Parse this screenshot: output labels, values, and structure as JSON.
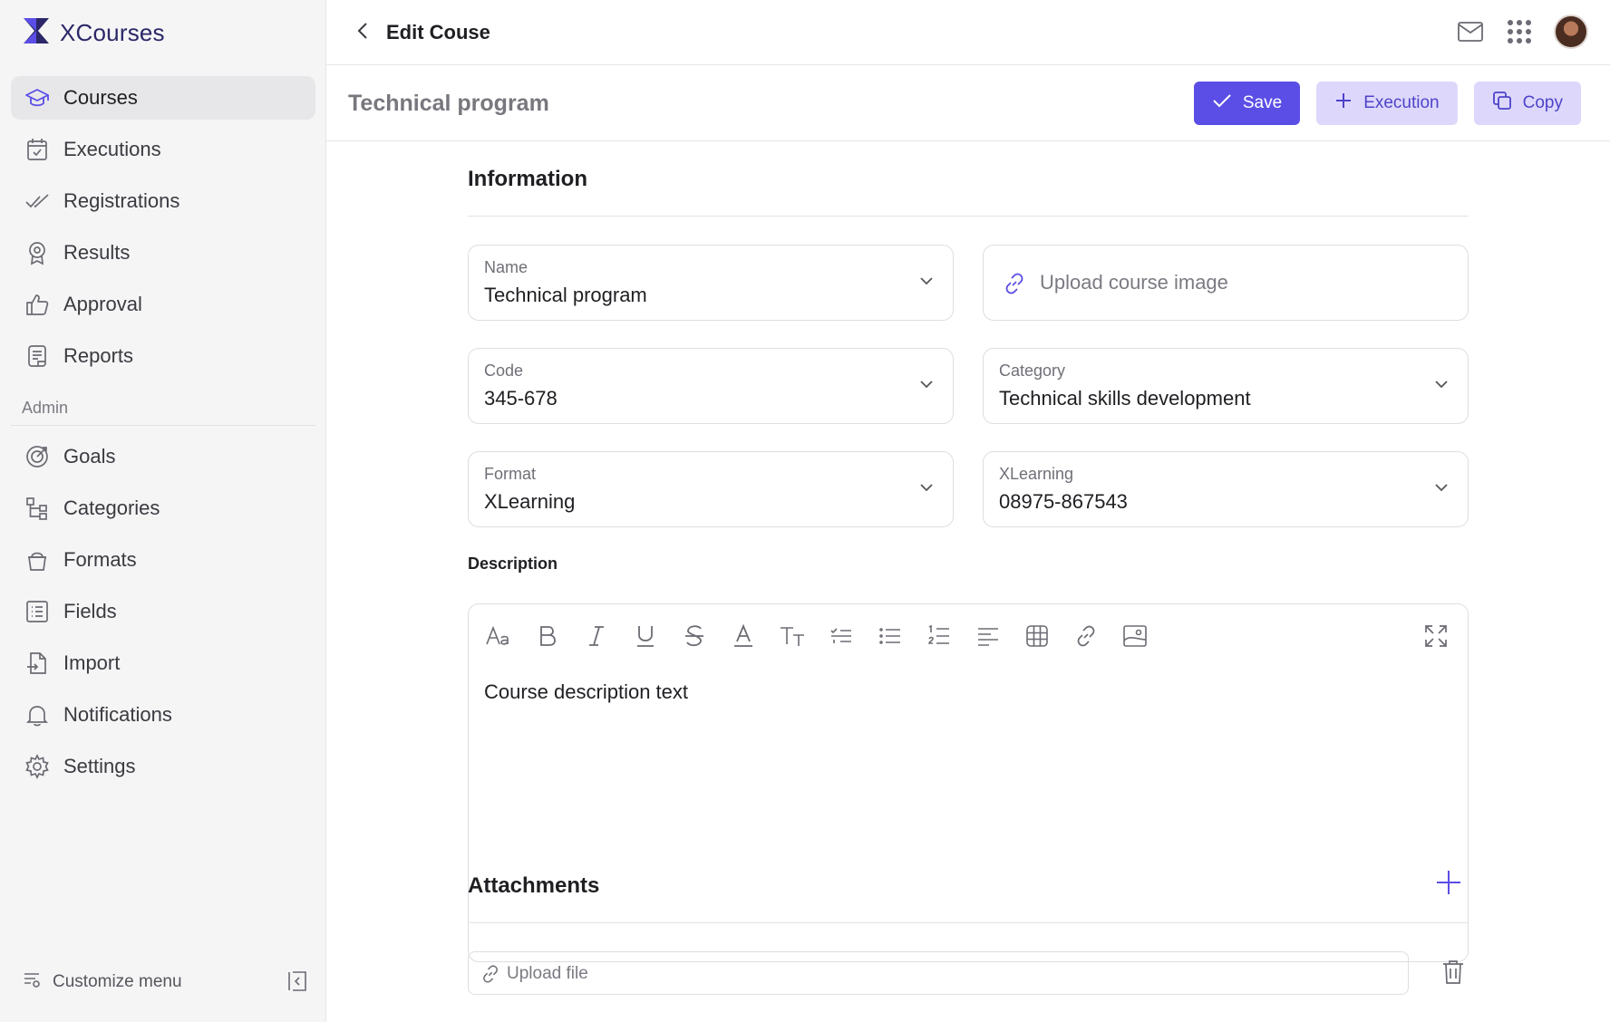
{
  "brand": {
    "name": "XCourses",
    "logo_icon": "x-logo-icon",
    "color": "#2b2768"
  },
  "sidebar": {
    "items": [
      {
        "label": "Courses",
        "icon": "graduation-cap-icon",
        "active": true
      },
      {
        "label": "Executions",
        "icon": "calendar-check-icon"
      },
      {
        "label": "Registrations",
        "icon": "double-check-icon"
      },
      {
        "label": "Results",
        "icon": "award-icon"
      },
      {
        "label": "Approval",
        "icon": "thumbs-up-icon"
      },
      {
        "label": "Reports",
        "icon": "report-icon"
      }
    ],
    "admin_label": "Admin",
    "admin_items": [
      {
        "label": "Goals",
        "icon": "target-icon"
      },
      {
        "label": "Categories",
        "icon": "hierarchy-icon"
      },
      {
        "label": "Formats",
        "icon": "basket-icon"
      },
      {
        "label": "Fields",
        "icon": "list-icon"
      },
      {
        "label": "Import",
        "icon": "file-import-icon"
      },
      {
        "label": "Notifications",
        "icon": "bell-icon"
      },
      {
        "label": "Settings",
        "icon": "gear-icon"
      }
    ],
    "footer": {
      "customize_label": "Customize menu"
    }
  },
  "topbar": {
    "title": "Edit Couse"
  },
  "subheader": {
    "record_title": "Technical program",
    "save_label": "Save",
    "execution_label": "Execution",
    "copy_label": "Copy"
  },
  "information": {
    "title": "Information",
    "name": {
      "label": "Name",
      "value": "Technical program"
    },
    "upload_image": {
      "placeholder": "Upload course image"
    },
    "code": {
      "label": "Code",
      "value": "345-678"
    },
    "category": {
      "label": "Category",
      "value": "Technical skills development"
    },
    "format": {
      "label": "Format",
      "value": "XLearning"
    },
    "xlearning": {
      "label": "XLearning",
      "value": "08975-867543"
    }
  },
  "description": {
    "label": "Description",
    "text": "Course description text"
  },
  "attachments": {
    "title": "Attachments",
    "upload_placeholder": "Upload file"
  },
  "colors": {
    "primary": "#5b4ee6",
    "soft": "#ddd8fb",
    "soft_text": "#4e43c9"
  }
}
